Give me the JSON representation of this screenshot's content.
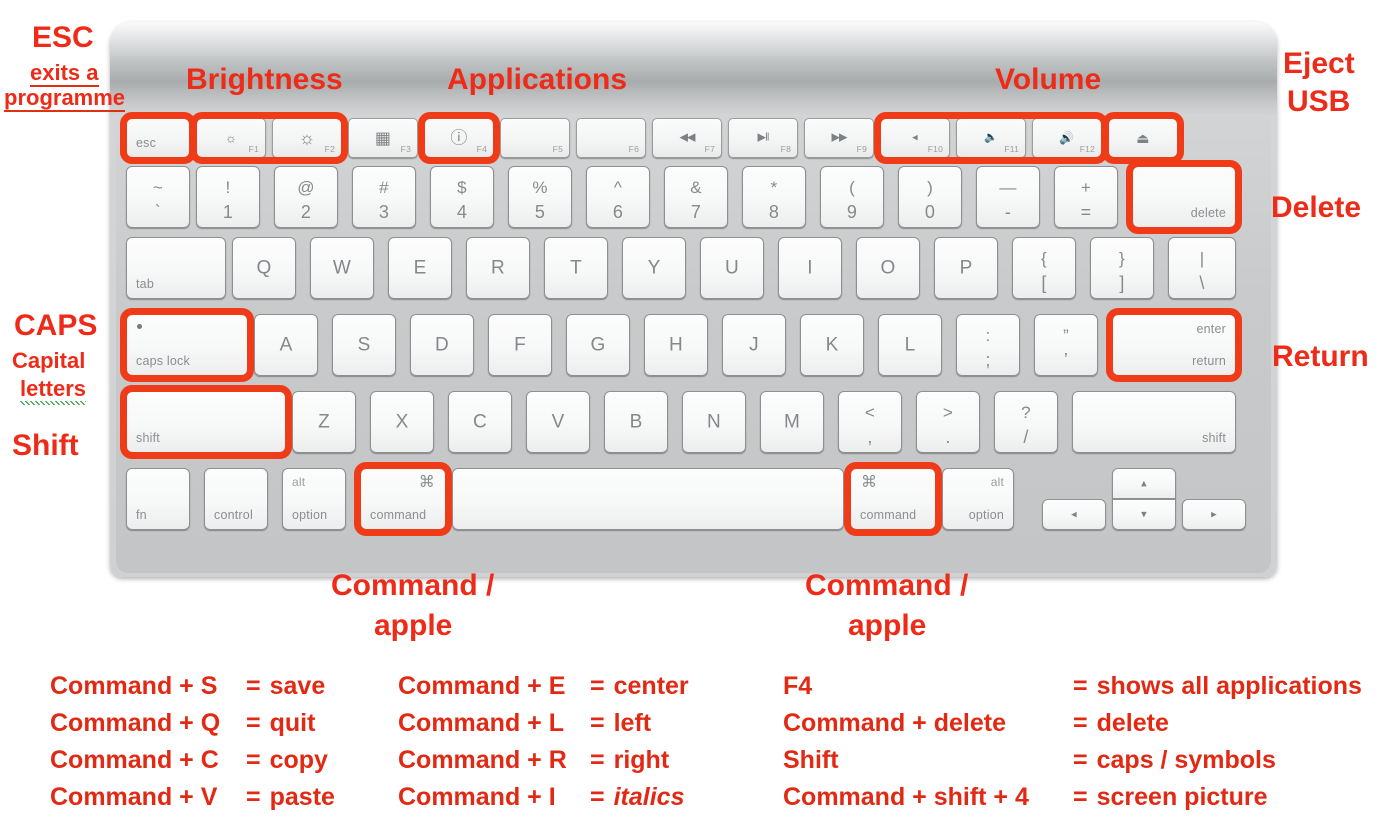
{
  "diagram": {
    "title": "Apple wireless keyboard shortcut reference",
    "accent_color": "#ee2b18",
    "highlight_ring_color": "#ef3b17"
  },
  "callouts": {
    "esc": {
      "title": "ESC",
      "line1": "exits a",
      "line2": "programme"
    },
    "brightness": "Brightness",
    "applications": "Applications",
    "volume": "Volume",
    "eject": {
      "line1": "Eject",
      "line2": "USB"
    },
    "delete": "Delete",
    "caps": {
      "title": "CAPS",
      "line1": "Capital",
      "line2": "letters"
    },
    "shift": "Shift",
    "return": "Return",
    "command_left": {
      "line1": "Command /",
      "line2": "apple"
    },
    "command_right": {
      "line1": "Command /",
      "line2": "apple"
    }
  },
  "keyboard": {
    "function_row": [
      {
        "label": "esc",
        "pos": "bl",
        "fnum": "",
        "icon": "",
        "highlight": true,
        "name": "key-esc"
      },
      {
        "label": "",
        "pos": "",
        "fnum": "F1",
        "icon": "brightness-down-icon",
        "glyph": "☀",
        "highlight": true,
        "name": "key-f1-brightness-down"
      },
      {
        "label": "",
        "pos": "",
        "fnum": "F2",
        "icon": "brightness-up-icon",
        "glyph": "☀",
        "highlight": true,
        "name": "key-f2-brightness-up"
      },
      {
        "label": "",
        "pos": "",
        "fnum": "F3",
        "icon": "mission-control-icon",
        "glyph": "▦",
        "highlight": false,
        "name": "key-f3-mission-control"
      },
      {
        "label": "",
        "pos": "",
        "fnum": "F4",
        "icon": "launchpad-icon",
        "glyph": "ⓘ",
        "highlight": true,
        "name": "key-f4-launchpad"
      },
      {
        "label": "",
        "pos": "",
        "fnum": "F5",
        "icon": "",
        "glyph": "",
        "highlight": false,
        "name": "key-f5"
      },
      {
        "label": "",
        "pos": "",
        "fnum": "F6",
        "icon": "",
        "glyph": "",
        "highlight": false,
        "name": "key-f6"
      },
      {
        "label": "",
        "pos": "",
        "fnum": "F7",
        "icon": "rewind-icon",
        "glyph": "◀◀",
        "highlight": false,
        "name": "key-f7-rewind"
      },
      {
        "label": "",
        "pos": "",
        "fnum": "F8",
        "icon": "play-pause-icon",
        "glyph": "▶‖",
        "highlight": false,
        "name": "key-f8-play-pause"
      },
      {
        "label": "",
        "pos": "",
        "fnum": "F9",
        "icon": "fast-forward-icon",
        "glyph": "▶▶",
        "highlight": false,
        "name": "key-f9-fast-forward"
      },
      {
        "label": "",
        "pos": "",
        "fnum": "F10",
        "icon": "volume-mute-icon",
        "glyph": "◂",
        "highlight": true,
        "name": "key-f10-volume-mute"
      },
      {
        "label": "",
        "pos": "",
        "fnum": "F11",
        "icon": "volume-down-icon",
        "glyph": "◂))",
        "highlight": true,
        "name": "key-f11-volume-down"
      },
      {
        "label": "",
        "pos": "",
        "fnum": "F12",
        "icon": "volume-up-icon",
        "glyph": "◂)))",
        "highlight": true,
        "name": "key-f12-volume-up"
      },
      {
        "label": "",
        "pos": "",
        "fnum": "",
        "icon": "eject-icon",
        "glyph": "⏏",
        "highlight": true,
        "name": "key-eject"
      }
    ],
    "number_row": [
      {
        "top": "~",
        "bottom": "`",
        "name": "key-tilde"
      },
      {
        "top": "!",
        "bottom": "1",
        "name": "key-1"
      },
      {
        "top": "@",
        "bottom": "2",
        "name": "key-2"
      },
      {
        "top": "#",
        "bottom": "3",
        "name": "key-3"
      },
      {
        "top": "$",
        "bottom": "4",
        "name": "key-4"
      },
      {
        "top": "%",
        "bottom": "5",
        "name": "key-5"
      },
      {
        "top": "^",
        "bottom": "6",
        "name": "key-6"
      },
      {
        "top": "&",
        "bottom": "7",
        "name": "key-7"
      },
      {
        "top": "*",
        "bottom": "8",
        "name": "key-8"
      },
      {
        "top": "(",
        "bottom": "9",
        "name": "key-9"
      },
      {
        "top": ")",
        "bottom": "0",
        "name": "key-0"
      },
      {
        "top": "—",
        "bottom": "-",
        "name": "key-minus"
      },
      {
        "top": "+",
        "bottom": "=",
        "name": "key-equals"
      }
    ],
    "delete_key": {
      "label": "delete",
      "highlight": true,
      "name": "key-delete"
    },
    "tab_key": {
      "label": "tab",
      "name": "key-tab"
    },
    "qwerty_row": [
      "Q",
      "W",
      "E",
      "R",
      "T",
      "Y",
      "U",
      "I",
      "O",
      "P"
    ],
    "qwerty_punct": [
      {
        "top": "{",
        "bottom": "[",
        "name": "key-bracket-left"
      },
      {
        "top": "}",
        "bottom": "]",
        "name": "key-bracket-right"
      },
      {
        "top": "|",
        "bottom": "\\",
        "name": "key-backslash"
      }
    ],
    "caps_key": {
      "label": "caps lock",
      "highlight": true,
      "name": "key-caps-lock"
    },
    "home_row": [
      "A",
      "S",
      "D",
      "F",
      "G",
      "H",
      "J",
      "K",
      "L"
    ],
    "home_punct": [
      {
        "top": ":",
        "bottom": ";",
        "name": "key-semicolon"
      },
      {
        "top": "”",
        "bottom": "’",
        "name": "key-quote"
      }
    ],
    "return_key": {
      "label_top": "enter",
      "label_bottom": "return",
      "highlight": true,
      "name": "key-return"
    },
    "shift_left": {
      "label": "shift",
      "highlight": true,
      "name": "key-shift-left"
    },
    "zxcv_row": [
      "Z",
      "X",
      "C",
      "V",
      "B",
      "N",
      "M"
    ],
    "zxcv_punct": [
      {
        "top": "<",
        "bottom": ",",
        "name": "key-comma"
      },
      {
        "top": ">",
        "bottom": ".",
        "name": "key-period"
      },
      {
        "top": "?",
        "bottom": "/",
        "name": "key-slash"
      }
    ],
    "shift_right": {
      "label": "shift",
      "highlight": false,
      "name": "key-shift-right"
    },
    "bottom_row": {
      "fn": {
        "label": "fn",
        "name": "key-fn"
      },
      "control": {
        "label": "control",
        "name": "key-control"
      },
      "option_left": {
        "alt": "alt",
        "label": "option",
        "name": "key-option-left"
      },
      "command_left": {
        "glyph": "⌘",
        "label": "command",
        "highlight": true,
        "name": "key-command-left"
      },
      "space": {
        "label": "",
        "name": "key-space"
      },
      "command_right": {
        "glyph": "⌘",
        "label": "command",
        "highlight": true,
        "name": "key-command-right"
      },
      "option_right": {
        "alt": "alt",
        "label": "option",
        "name": "key-option-right"
      },
      "arrow_left": {
        "glyph": "◂",
        "name": "key-arrow-left"
      },
      "arrow_up": {
        "glyph": "▴",
        "name": "key-arrow-up"
      },
      "arrow_down": {
        "glyph": "▾",
        "name": "key-arrow-down"
      },
      "arrow_right": {
        "glyph": "▸",
        "name": "key-arrow-right"
      }
    }
  },
  "shortcuts": {
    "column1": [
      {
        "keys": "Command + S",
        "eq": "=",
        "action": "save",
        "italic": false
      },
      {
        "keys": "Command + Q",
        "eq": "=",
        "action": "quit",
        "italic": false
      },
      {
        "keys": "Command + C",
        "eq": "=",
        "action": "copy",
        "italic": false
      },
      {
        "keys": "Command + V",
        "eq": "=",
        "action": "paste",
        "italic": false
      }
    ],
    "column2": [
      {
        "keys": "Command + E",
        "eq": "=",
        "action": "center",
        "italic": false
      },
      {
        "keys": "Command + L",
        "eq": "=",
        "action": "left",
        "italic": false
      },
      {
        "keys": "Command + R",
        "eq": "=",
        "action": "right",
        "italic": false
      },
      {
        "keys": "Command + I",
        "eq": "=",
        "action": "italics",
        "italic": true
      }
    ],
    "column3": [
      {
        "keys": "F4",
        "eq": "=",
        "action": "shows all applications",
        "italic": false
      },
      {
        "keys": "Command + delete",
        "eq": "=",
        "action": "delete",
        "italic": false
      },
      {
        "keys": "Shift",
        "eq": "=",
        "action": "caps / symbols",
        "italic": false
      },
      {
        "keys": "Command + shift + 4",
        "eq": "=",
        "action": "screen picture",
        "italic": false
      }
    ]
  }
}
